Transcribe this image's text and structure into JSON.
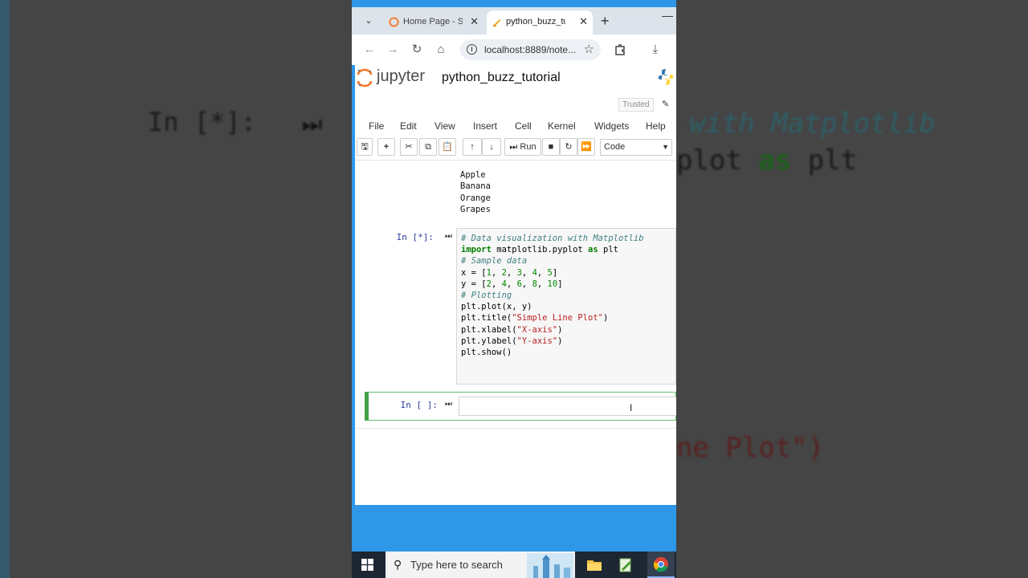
{
  "background": {
    "prompt": "In [*]:",
    "comment": "with Matplotlib",
    "import_line_kw": "as",
    "import_line_pre": "plot ",
    "import_line_post": " plt",
    "plot_fragment": "ne Plot\")"
  },
  "browser": {
    "tabs": [
      {
        "label": "Home Page - Sel",
        "icon": "jupyter-icon"
      },
      {
        "label": "python_buzz_tut",
        "icon": "notebook-icon"
      }
    ],
    "url": "localhost:8889/note..."
  },
  "jupyter": {
    "brand": "jupyter",
    "notebook_name": "python_buzz_tutorial",
    "trusted": "Trusted",
    "menu": [
      "File",
      "Edit",
      "View",
      "Insert",
      "Cell",
      "Kernel",
      "Widgets",
      "Help"
    ],
    "toolbar": {
      "run_label": "Run",
      "cell_type": "Code"
    },
    "output_lines": [
      "Apple",
      "Banana",
      "Orange",
      "Grapes"
    ],
    "code_cell": {
      "prompt": "In [*]:",
      "lines": [
        "# Data visualization with Matplotlib",
        "import matplotlib.pyplot as plt",
        "",
        "# Sample data",
        "x = [1, 2, 3, 4, 5]",
        "y = [2, 4, 6, 8, 10]",
        "",
        "# Plotting",
        "plt.plot(x, y)",
        "plt.title(\"Simple Line Plot\")",
        "plt.xlabel(\"X-axis\")",
        "plt.ylabel(\"Y-axis\")",
        "plt.show()"
      ]
    },
    "empty_cell_prompt": "In [ ]:"
  },
  "taskbar": {
    "search_placeholder": "Type here to search"
  },
  "colors": {
    "frame_blue": "#2e97e8",
    "jupyter_orange": "#f37726",
    "active_cell_green": "#42a047",
    "prompt_blue": "#303f9f"
  }
}
